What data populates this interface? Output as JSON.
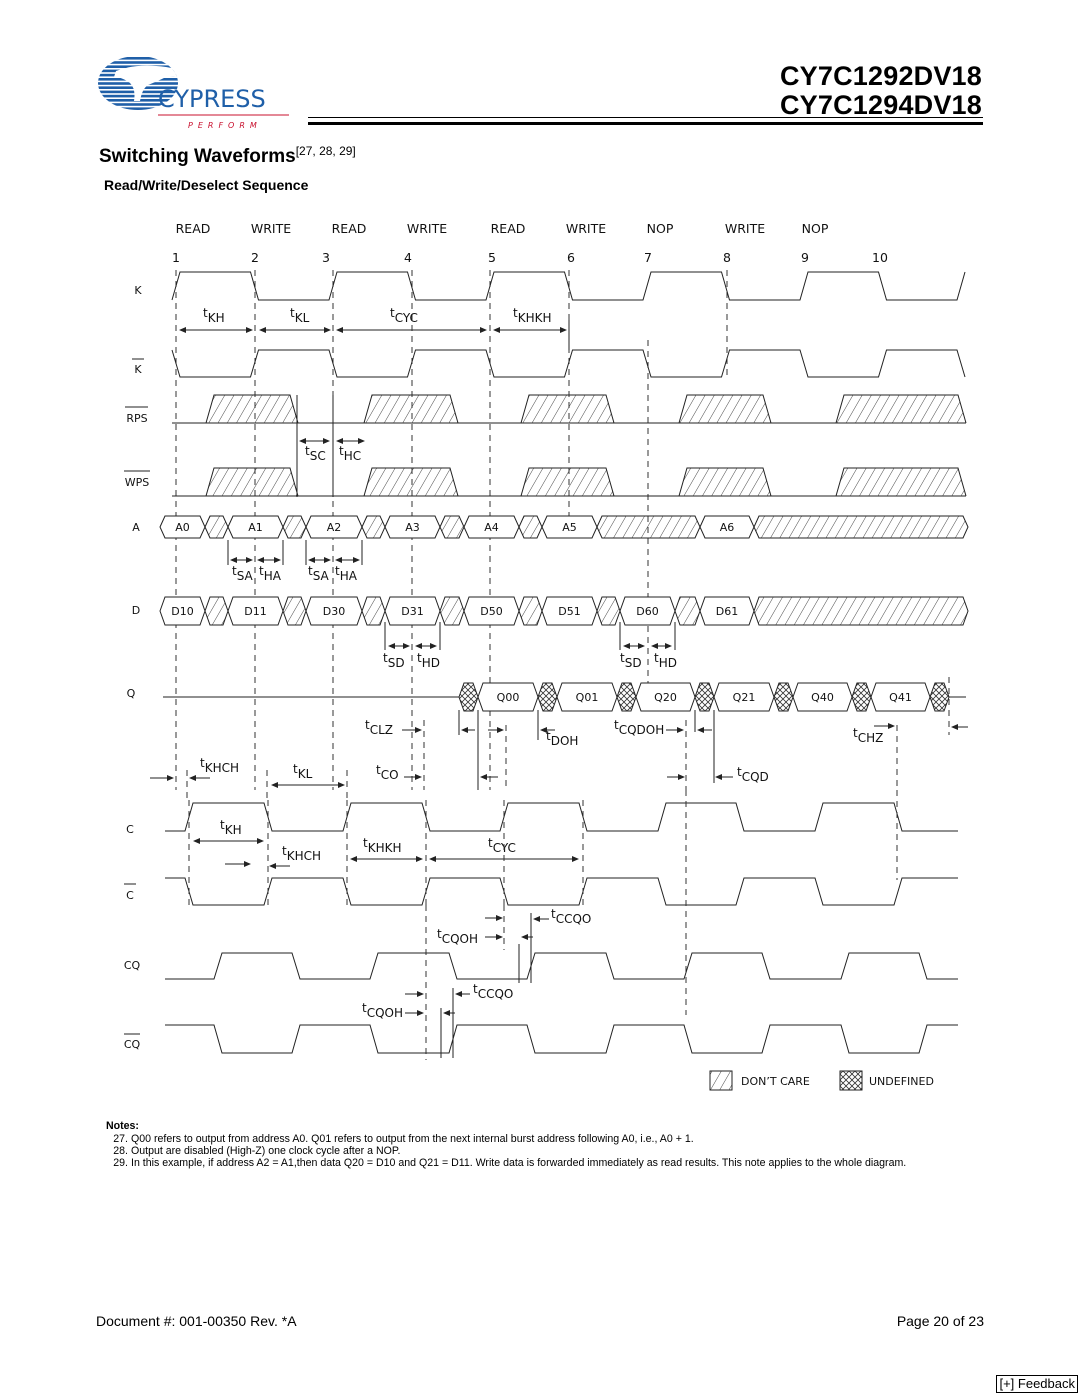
{
  "header": {
    "logo": {
      "brand": "CYPRESS",
      "tagline": "PERFORM",
      "colors": {
        "blue": "#1f5fa8",
        "red": "#c8102e"
      }
    },
    "part_numbers": [
      "CY7C1292DV18",
      "CY7C1294DV18"
    ]
  },
  "section": {
    "title": "Switching Waveforms",
    "refs": "[27, 28, 29]",
    "subtitle": "Read/Write/Deselect Sequence"
  },
  "diagram": {
    "operations": [
      "READ",
      "WRITE",
      "READ",
      "WRITE",
      "READ",
      "WRITE",
      "NOP",
      "WRITE",
      "NOP"
    ],
    "cycle_numbers": [
      "1",
      "2",
      "3",
      "4",
      "5",
      "6",
      "7",
      "8",
      "9",
      "10"
    ],
    "signals": {
      "K": "K",
      "K_bar": "K",
      "RPS": "RPS",
      "WPS": "WPS",
      "A": "A",
      "D": "D",
      "Q": "Q",
      "C": "C",
      "C_bar": "C",
      "CQ": "CQ",
      "CQ_bar": "CQ"
    },
    "address_values": [
      "A0",
      "A1",
      "A2",
      "A3",
      "A4",
      "A5",
      "A6"
    ],
    "data_in_values": [
      "D10",
      "D11",
      "D30",
      "D31",
      "D50",
      "D51",
      "D60",
      "D61"
    ],
    "data_out_values": [
      "Q00",
      "Q01",
      "Q20",
      "Q21",
      "Q40",
      "Q41"
    ],
    "timing_labels": {
      "tKH": [
        "t",
        "KH"
      ],
      "tKL": [
        "t",
        "KL"
      ],
      "tCYC": [
        "t",
        "CYC"
      ],
      "tKHKH": [
        "t",
        "KHKH"
      ],
      "tSC": [
        "t",
        "SC"
      ],
      "tHC": [
        "t",
        "HC"
      ],
      "tSA": [
        "t",
        "SA"
      ],
      "tHA": [
        "t",
        "HA"
      ],
      "tSD": [
        "t",
        "SD"
      ],
      "tHD": [
        "t",
        "HD"
      ],
      "tCLZ": [
        "t",
        "CLZ"
      ],
      "tDOH": [
        "t",
        "DOH"
      ],
      "tCQDOH": [
        "t",
        "CQDOH"
      ],
      "tCHZ": [
        "t",
        "CHZ"
      ],
      "tKHCH": [
        "t",
        "KHCH"
      ],
      "tCO": [
        "t",
        "CO"
      ],
      "tCQD": [
        "t",
        "CQD"
      ],
      "tCCQO": [
        "t",
        "CCQO"
      ],
      "tCQOH": [
        "t",
        "CQOH"
      ]
    },
    "legend": {
      "dont_care": "DON’T CARE",
      "undefined": "UNDEFINED"
    }
  },
  "notes": {
    "header": "Notes:",
    "items": [
      {
        "num": "27.",
        "text": "Q00 refers to output from address A0. Q01 refers to output from the next internal burst address following A0, i.e., A0 + 1."
      },
      {
        "num": "28.",
        "text": "Output are disabled (High-Z) one clock cycle after a NOP."
      },
      {
        "num": "29.",
        "text": "In this example, if address A2 = A1,then data Q20 = D10 and Q21 = D11. Write data is forwarded immediately as read results. This note applies to the whole diagram."
      }
    ]
  },
  "footer": {
    "document": "Document #: 001-00350 Rev. *A",
    "page": "Page 20 of 23",
    "feedback": "[+] Feedback"
  }
}
